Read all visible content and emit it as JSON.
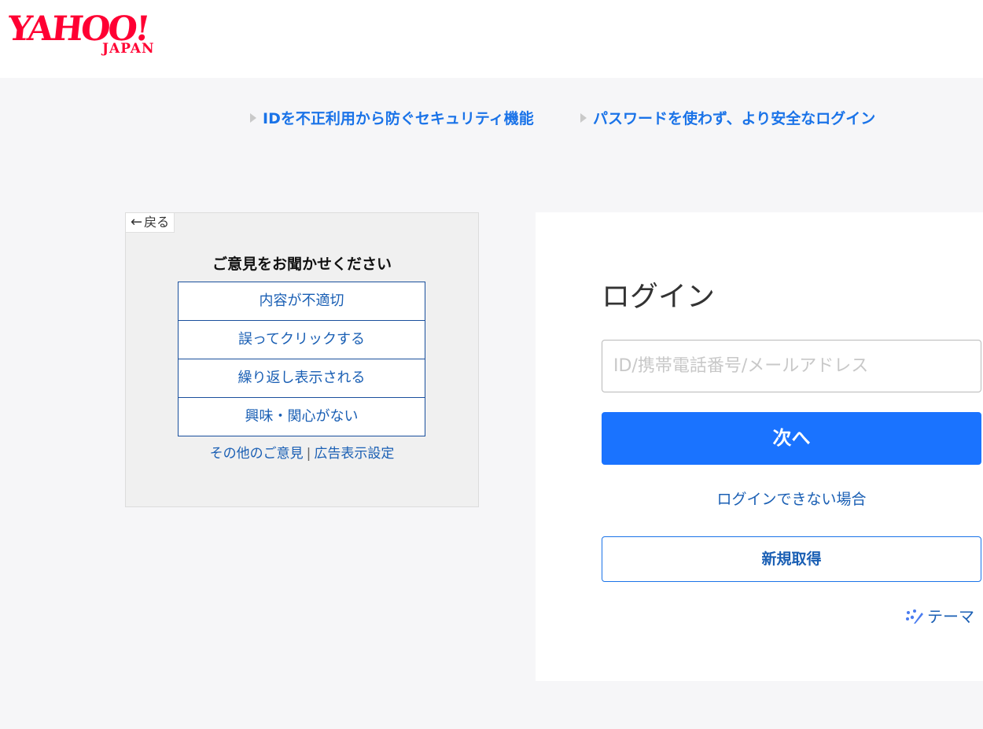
{
  "header": {
    "logo_yahoo": "YAHOO!",
    "logo_japan": "JAPAN"
  },
  "promo_links": [
    {
      "label": "IDを不正利用から防ぐセキュリティ機能"
    },
    {
      "label": "パスワードを使わず、より安全なログイン"
    }
  ],
  "ad_feedback": {
    "back_label": "戻る",
    "title": "ご意見をお聞かせください",
    "options": [
      {
        "label": "内容が不適切"
      },
      {
        "label": "誤ってクリックする"
      },
      {
        "label": "繰り返し表示される"
      },
      {
        "label": "興味・関心がない"
      }
    ],
    "other_feedback": "その他のご意見",
    "separator": "|",
    "ad_settings": "広告表示設定"
  },
  "login": {
    "title": "ログイン",
    "id_placeholder": "ID/携帯電話番号/メールアドレス",
    "id_value": "",
    "next_label": "次へ",
    "cant_login": "ログインできない場合",
    "signup_label": "新規取得",
    "theme_label": "テーマ"
  },
  "colors": {
    "brand_red": "#ff0033",
    "link_blue": "#1a5fb4",
    "primary_button": "#1a73ff"
  }
}
